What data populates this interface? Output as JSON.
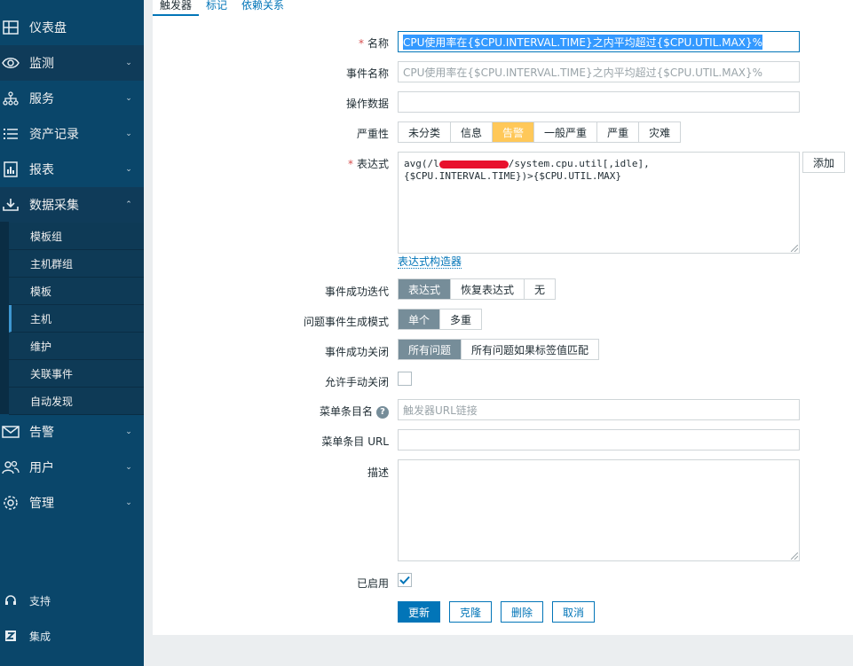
{
  "sidebar": {
    "items": [
      {
        "label": "仪表盘",
        "icon": "dashboard-icon"
      },
      {
        "label": "监测",
        "icon": "eye-icon"
      },
      {
        "label": "服务",
        "icon": "services-icon"
      },
      {
        "label": "资产记录",
        "icon": "list-icon"
      },
      {
        "label": "报表",
        "icon": "report-icon"
      },
      {
        "label": "数据采集",
        "icon": "download-icon"
      }
    ],
    "subitems": [
      "模板组",
      "主机群组",
      "模板",
      "主机",
      "维护",
      "关联事件",
      "自动发现"
    ],
    "items_after": [
      {
        "label": "告警",
        "icon": "mail-icon"
      },
      {
        "label": "用户",
        "icon": "users-icon"
      },
      {
        "label": "管理",
        "icon": "gear-icon"
      }
    ],
    "footer": [
      {
        "label": "支持",
        "icon": "headset-icon"
      },
      {
        "label": "集成",
        "icon": "zabbix-icon"
      }
    ]
  },
  "tabs": [
    "触发器",
    "标记",
    "依赖关系"
  ],
  "form": {
    "name_label": "名称",
    "name_value": "CPU使用率在{$CPU.INTERVAL.TIME}之内平均超过{$CPU.UTIL.MAX}%",
    "event_name_label": "事件名称",
    "event_name_placeholder": "CPU使用率在{$CPU.INTERVAL.TIME}之内平均超过{$CPU.UTIL.MAX}%",
    "opdata_label": "操作数据",
    "opdata_value": "",
    "severity_label": "严重性",
    "severity_options": [
      "未分类",
      "信息",
      "告警",
      "一般严重",
      "严重",
      "灾难"
    ],
    "severity_selected": "告警",
    "expression_label": "表达式",
    "expression_line1_prefix": "avg(/l",
    "expression_line1_suffix": "/system.cpu.util[,idle],",
    "expression_line2": "{$CPU.INTERVAL.TIME})>{$CPU.UTIL.MAX}",
    "add_button": "添加",
    "expression_builder": "表达式构造器",
    "ok_event_gen_label": "事件成功迭代",
    "ok_event_gen_options": [
      "表达式",
      "恢复表达式",
      "无"
    ],
    "problem_mode_label": "问题事件生成模式",
    "problem_mode_options": [
      "单个",
      "多重"
    ],
    "ok_close_label": "事件成功关闭",
    "ok_close_options": [
      "所有问题",
      "所有问题如果标签值匹配"
    ],
    "manual_close_label": "允许手动关闭",
    "manual_close_checked": false,
    "menu_name_label": "菜单条目名",
    "menu_name_placeholder": "触发器URL链接",
    "menu_url_label": "菜单条目 URL",
    "menu_url_value": "",
    "description_label": "描述",
    "description_value": "",
    "enabled_label": "已启用",
    "enabled_checked": true
  },
  "buttons": {
    "update": "更新",
    "clone": "克隆",
    "delete": "删除",
    "cancel": "取消"
  },
  "colors": {
    "sidebar": "#0a466a",
    "primary": "#0275b8",
    "warning": "#ffc859",
    "selected_gray": "#768d99"
  }
}
